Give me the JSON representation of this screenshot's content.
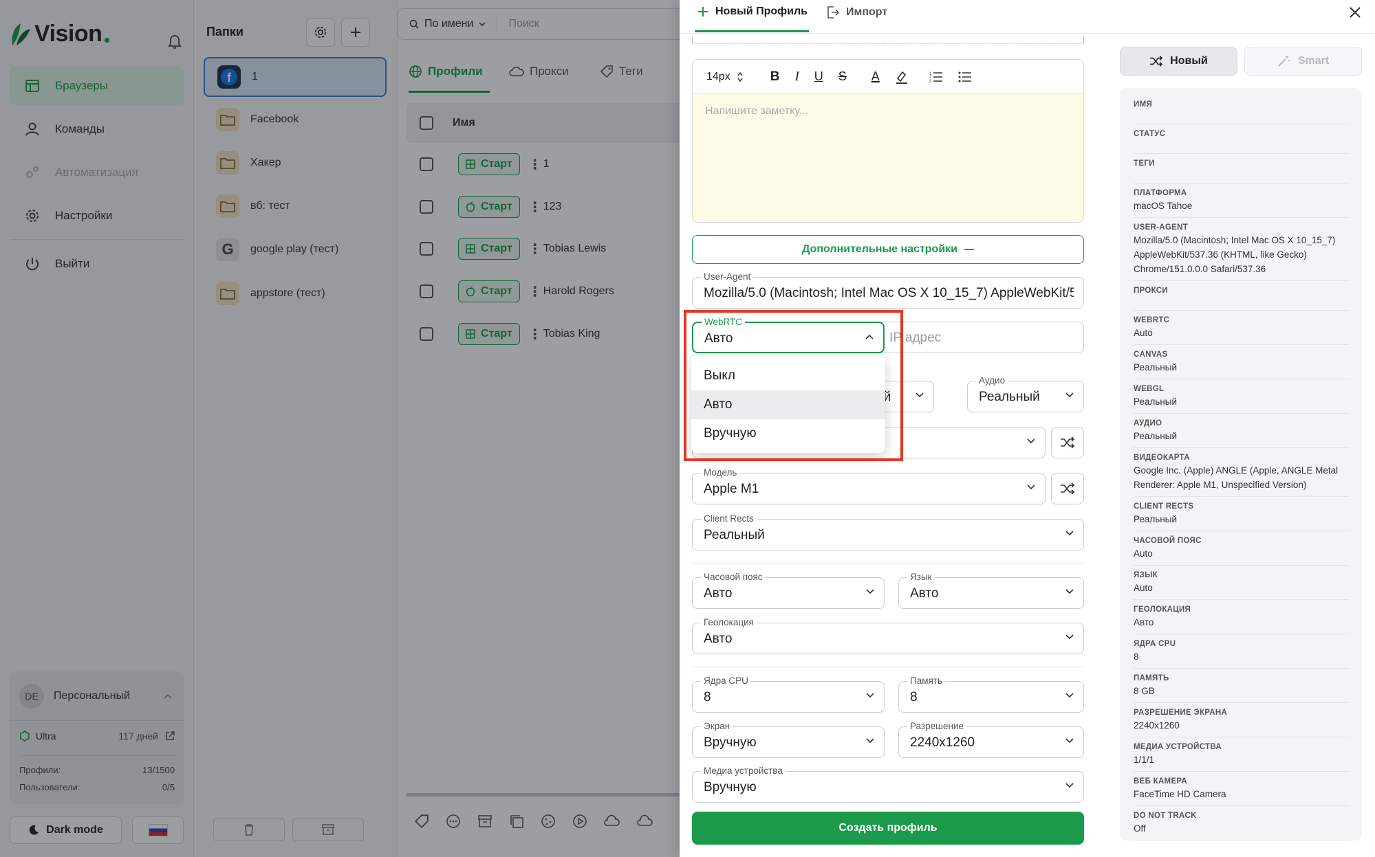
{
  "sidebar": {
    "logo": "Vision",
    "nav": [
      {
        "label": "Браузеры",
        "icon": "browser-icon",
        "state": "active"
      },
      {
        "label": "Команды",
        "icon": "user-icon",
        "state": "normal"
      },
      {
        "label": "Автоматизация",
        "icon": "automation-icon",
        "state": "disabled"
      },
      {
        "label": "Настройки",
        "icon": "gear-icon",
        "state": "normal"
      },
      {
        "label": "Выйти",
        "icon": "power-icon",
        "state": "normal"
      }
    ],
    "account": {
      "initials": "DE",
      "name": "Персональный",
      "plan": "Ultra",
      "days": "117 дней",
      "profiles_label": "Профили:",
      "profiles_value": "13/1500",
      "users_label": "Пользователи:",
      "users_value": "0/5"
    },
    "dark_mode_label": "Dark mode"
  },
  "folders": {
    "title": "Папки",
    "items": [
      {
        "label": "1",
        "icon": "facebook-icon"
      },
      {
        "label": "Facebook",
        "icon": "folder-icon"
      },
      {
        "label": "Хакер",
        "icon": "folder-icon"
      },
      {
        "label": "вб: тест",
        "icon": "folder-icon"
      },
      {
        "label": "google play (тест)",
        "icon": "google-icon"
      },
      {
        "label": "appstore (тест)",
        "icon": "folder-icon"
      }
    ]
  },
  "main": {
    "sort_label": "По имени",
    "search_placeholder": "Поиск",
    "tabs": [
      "Профили",
      "Прокси",
      "Теги"
    ],
    "column_name": "Имя",
    "start_label": "Старт",
    "rows": [
      {
        "name": "1",
        "os": "windows"
      },
      {
        "name": "123",
        "os": "mac"
      },
      {
        "name": "Tobias Lewis",
        "os": "windows"
      },
      {
        "name": "Harold Rogers",
        "os": "mac"
      },
      {
        "name": "Tobias King",
        "os": "windows"
      }
    ]
  },
  "drawer": {
    "tab_new": "Новый Профиль",
    "tab_import": "Импорт",
    "font_size": "14px",
    "note_placeholder": "Напишите заметку...",
    "advanced_label": "Дополнительные настройки",
    "user_agent_label": "User-Agent",
    "user_agent_value": "Mozilla/5.0 (Macintosh; Intel Mac OS X 10_15_7) AppleWebKit/537.36",
    "webrtc_label": "WebRTC",
    "webrtc_value": "Авто",
    "ip_placeholder": "IP адрес",
    "hidden_value_suffix": "ый",
    "audio_label": "Аудио",
    "audio_value": "Реальный",
    "model_label": "Модель",
    "model_value": "Apple M1",
    "client_rects_label": "Client Rects",
    "client_rects_value": "Реальный",
    "timezone_label": "Часовой пояс",
    "timezone_value": "Авто",
    "language_label": "Язык",
    "language_value": "Авто",
    "geo_label": "Геолокация",
    "geo_value": "Авто",
    "cpu_label": "Ядра CPU",
    "cpu_value": "8",
    "memory_label": "Память",
    "memory_value": "8",
    "screen_label": "Экран",
    "screen_value": "Вручную",
    "resolution_label": "Разрешение",
    "resolution_value": "2240x1260",
    "media_label": "Медиа устройства",
    "media_value": "Вручную",
    "create_button": "Создать профиль",
    "mode_new": "Новый",
    "mode_smart": "Smart",
    "webrtc_options": [
      "Выкл",
      "Авто",
      "Вручную"
    ],
    "webrtc_selected": "Авто"
  },
  "preview": [
    {
      "key": "Имя",
      "value": ""
    },
    {
      "key": "Статус",
      "value": ""
    },
    {
      "key": "Теги",
      "value": ""
    },
    {
      "key": "Платформа",
      "value": "macOS Tahoe"
    },
    {
      "key": "User-Agent",
      "value": "Mozilla/5.0 (Macintosh; Intel Mac OS X 10_15_7) AppleWebKit/537.36 (KHTML, like Gecko) Chrome/151.0.0.0 Safari/537.36"
    },
    {
      "key": "Прокси",
      "value": ""
    },
    {
      "key": "WebRTC",
      "value": "Auto"
    },
    {
      "key": "Canvas",
      "value": "Реальный"
    },
    {
      "key": "WebGL",
      "value": "Реальный"
    },
    {
      "key": "Аудио",
      "value": "Реальный"
    },
    {
      "key": "Видеокарта",
      "value": "Google Inc. (Apple) ANGLE (Apple, ANGLE Metal Renderer: Apple M1, Unspecified Version)"
    },
    {
      "key": "Client Rects",
      "value": "Реальный"
    },
    {
      "key": "Часовой пояс",
      "value": "Auto"
    },
    {
      "key": "Язык",
      "value": "Auto"
    },
    {
      "key": "Геолокация",
      "value": "Авто"
    },
    {
      "key": "Ядра CPU",
      "value": "8"
    },
    {
      "key": "Память",
      "value": "8 GB"
    },
    {
      "key": "Разрешение экрана",
      "value": "2240x1260"
    },
    {
      "key": "Медиа устройства",
      "value": "1/1/1"
    },
    {
      "key": "Веб камера",
      "value": "FaceTime HD Camera"
    },
    {
      "key": "Do Not Track",
      "value": "Off"
    }
  ],
  "colors": {
    "accent_green": "#1a9a4a",
    "highlight_red": "#e53824",
    "note_bg": "#fdfbe6",
    "active_folder": "#3d7bd9"
  }
}
